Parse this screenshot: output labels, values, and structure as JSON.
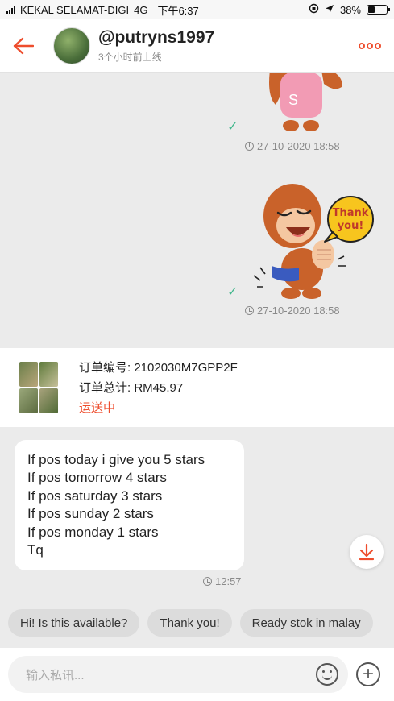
{
  "status_bar": {
    "carrier": "KEKAL SELAMAT-DIGI",
    "network": "4G",
    "time": "下午6:37",
    "battery": "38%",
    "battery_level": 0.38
  },
  "header": {
    "back_icon": "arrow-left-icon",
    "username": "@putryns1997",
    "last_seen": "3个小时前上线",
    "more_icon": "more-dots-icon"
  },
  "messages": [
    {
      "type": "sticker",
      "sticker": "monkey-pink-shirt",
      "status": "read",
      "timestamp": "27-10-2020 18:58"
    },
    {
      "type": "sticker",
      "sticker": "monkey-thank-you",
      "bubble_text": "Thank you!",
      "status": "read",
      "timestamp": "27-10-2020 18:58"
    }
  ],
  "order": {
    "number_label": "订单编号: 2102030M7GPP2F",
    "total_label": "订单总计: RM45.97",
    "status": "运送中"
  },
  "incoming": {
    "lines": [
      "If pos today i give you 5 stars",
      "If pos tomorrow 4 stars",
      "If pos saturday 3 stars",
      "If pos sunday 2 stars",
      "If pos monday 1 stars",
      "Tq"
    ],
    "timestamp": "12:57"
  },
  "quick_replies": [
    "Hi! Is this available?",
    "Thank you!",
    "Ready stok in malay"
  ],
  "input": {
    "placeholder": "输入私讯..."
  },
  "colors": {
    "accent": "#ee4d2d",
    "check": "#3fb68b",
    "background": "#ebebeb"
  }
}
